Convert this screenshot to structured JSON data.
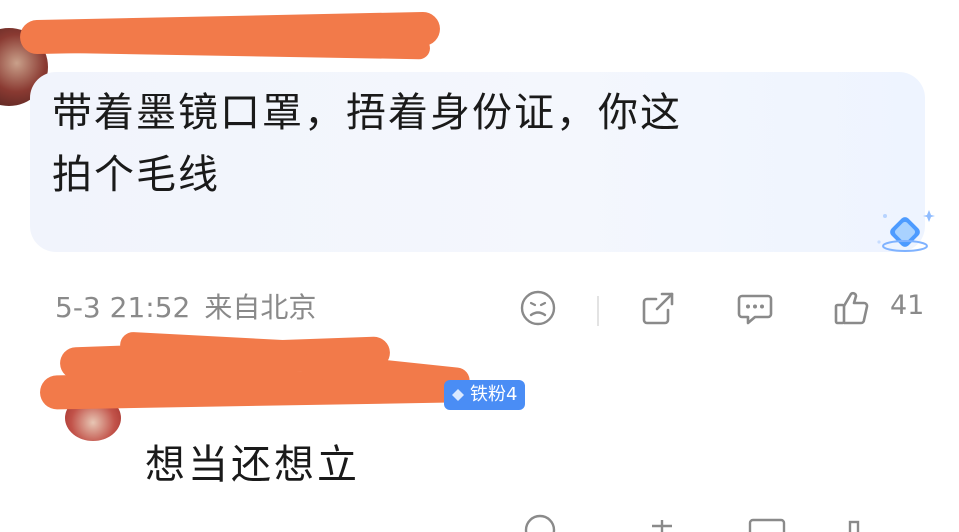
{
  "comment": {
    "badge_fragment": "4",
    "text": "带着墨镜口罩，捂着身份证，你这拍个毛线",
    "line1": "带着墨镜口罩，捂着身份证，你这",
    "line2": "拍个毛线",
    "time": "5-3 21:52",
    "location": "来自北京",
    "like_count": "41",
    "icons": [
      "sad-face-icon",
      "share-icon",
      "comment-icon",
      "thumbs-up-icon",
      "diamond-sparkle-icon"
    ]
  },
  "reply": {
    "badge": "铁粉4",
    "text": "想当还想立"
  },
  "colors": {
    "redaction": "#f27a4a",
    "badge_blue": "#4a8df5",
    "meta_gray": "#8a8a8a",
    "bubble": "#f1f4fc"
  }
}
